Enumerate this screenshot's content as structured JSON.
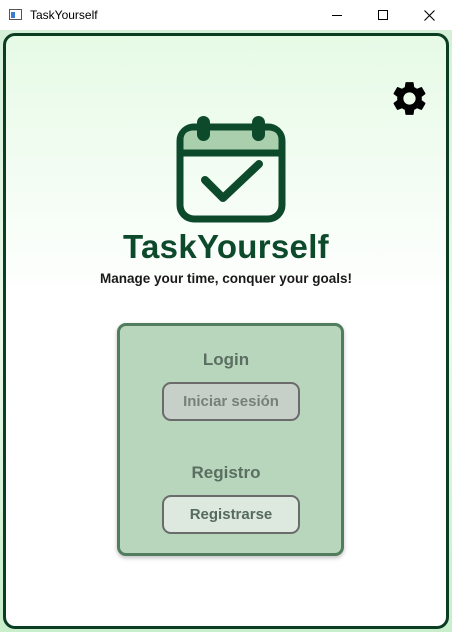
{
  "window": {
    "title": "TaskYourself",
    "icon": "app-window-icon"
  },
  "colors": {
    "brand_dark": "#0d4a2b",
    "panel_bg": "#b7d6bb",
    "panel_border": "#4f7d5d",
    "frame_border": "#0b3d22"
  },
  "header": {
    "settings_icon": "gear-icon",
    "logo_icon": "calendar-check-icon",
    "app_name": "TaskYourself",
    "tagline": "Manage your time, conquer your goals!"
  },
  "auth_panel": {
    "login": {
      "heading": "Login",
      "button_label": "Iniciar sesión"
    },
    "register": {
      "heading": "Registro",
      "button_label": "Registrarse"
    }
  }
}
